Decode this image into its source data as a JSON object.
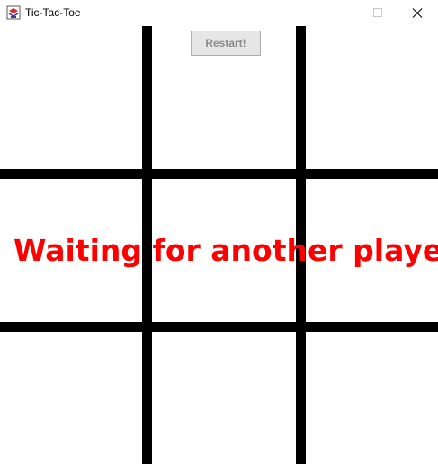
{
  "window": {
    "title": "Tic-Tac-Toe",
    "icon": "java-cup-icon",
    "controls": {
      "minimize_icon": "minimize-icon",
      "maximize_icon": "maximize-icon",
      "close_icon": "close-icon"
    }
  },
  "toolbar": {
    "restart_label": "Restart!"
  },
  "status": {
    "message": "Waiting for another player",
    "color": "#ff0000"
  },
  "board": {
    "line_color": "#000000",
    "cells": [
      "",
      "",
      "",
      "",
      "",
      "",
      "",
      "",
      ""
    ]
  }
}
